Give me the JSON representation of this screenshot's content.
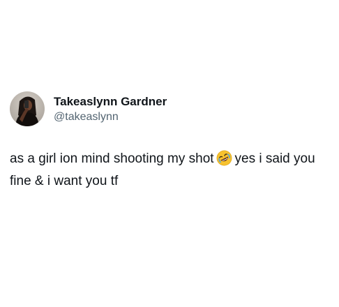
{
  "tweet": {
    "author": {
      "display_name": "Takeaslynn Gardner",
      "handle": "@takeaslynn",
      "avatar_icon": "profile-photo-avatar"
    },
    "text_before_emoji": "as a girl ion mind shooting my shot",
    "emoji": {
      "name": "rolling-on-the-floor-laughing-icon",
      "char": "🤣"
    },
    "text_after_emoji": "yes i said you fine & i want you tf"
  },
  "colors": {
    "text_primary": "#0f1419",
    "text_secondary": "#536471",
    "background": "#ffffff",
    "emoji_face": "#f7c22f"
  }
}
